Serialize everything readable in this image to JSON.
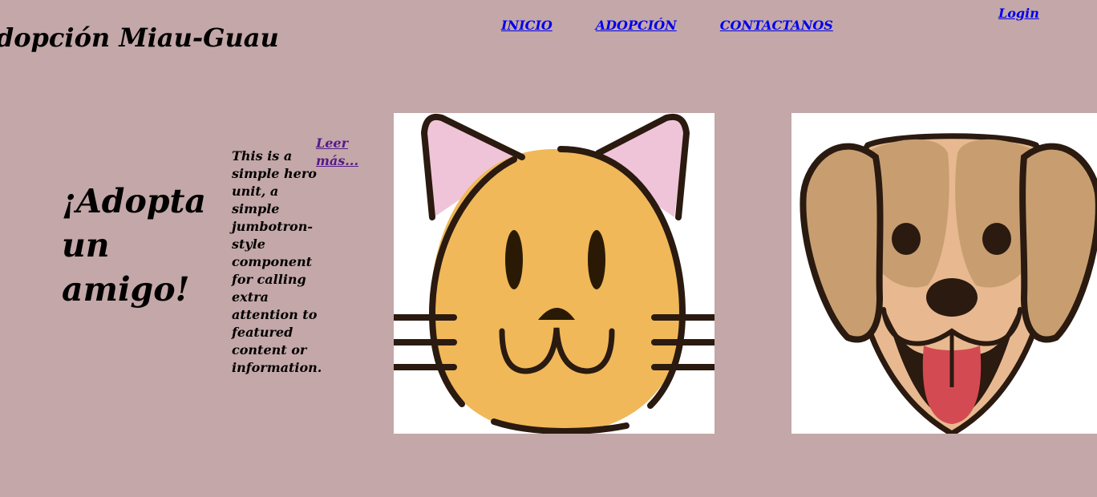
{
  "header": {
    "site_title": "Adopción Miau-Guau",
    "nav": {
      "home": "INICIO",
      "adoption": "ADOPCIÓN",
      "contact": "CONTACTANOS"
    },
    "login": "Login"
  },
  "hero": {
    "heading": "¡Adopta un amigo!",
    "description": "This is a simple hero unit, a simple jumbotron-style component for calling extra attention to featured content or information.",
    "read_more": "Leer más..."
  },
  "images": {
    "cat_icon": "cat-face-icon",
    "dog_icon": "dog-face-icon"
  },
  "colors": {
    "background": "#c4a7a8",
    "link": "#0000ee",
    "visited_link": "#551a8b",
    "cat_fur": "#f0b858",
    "cat_ears": "#f0c4d8",
    "dog_fur": "#c89e70",
    "dog_muzzle": "#e8b990",
    "dog_tongue": "#d44a52",
    "outline": "#2a1a10"
  }
}
